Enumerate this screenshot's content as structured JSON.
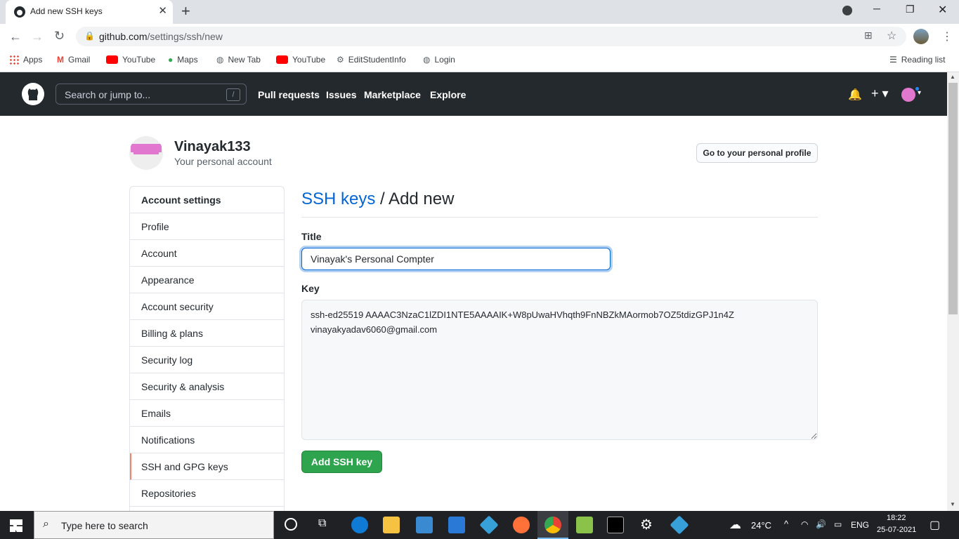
{
  "browser": {
    "tab_title": "Add new SSH keys",
    "url_host": "github.com",
    "url_path": "/settings/ssh/new",
    "bookmarks": [
      "Apps",
      "Gmail",
      "YouTube",
      "Maps",
      "New Tab",
      "YouTube",
      "EditStudentInfo",
      "Login"
    ],
    "reading_list": "Reading list"
  },
  "github": {
    "search_placeholder": "Search or jump to...",
    "search_shortcut": "/",
    "nav": [
      "Pull requests",
      "Issues",
      "Marketplace",
      "Explore"
    ]
  },
  "account": {
    "username": "Vinayak133",
    "subtitle": "Your personal account",
    "profile_button": "Go to your personal profile"
  },
  "sidebar": {
    "heading": "Account settings",
    "items": [
      "Profile",
      "Account",
      "Appearance",
      "Account security",
      "Billing & plans",
      "Security log",
      "Security & analysis",
      "Emails",
      "Notifications",
      "SSH and GPG keys",
      "Repositories"
    ],
    "active": "SSH and GPG keys"
  },
  "form": {
    "breadcrumb_link": "SSH keys",
    "breadcrumb_rest": " / Add new",
    "title_label": "Title",
    "title_value": "Vinayak's Personal Compter",
    "key_label": "Key",
    "key_value": "ssh-ed25519 AAAAC3NzaC1lZDI1NTE5AAAAIK+W8pUwaHVhqth9FnNBZkMAormob7OZ5tdizGPJ1n4Z vinayakyadav6060@gmail.com",
    "submit_label": "Add SSH key"
  },
  "taskbar": {
    "search_placeholder": "Type here to search",
    "weather": "24°C",
    "language": "ENG",
    "time": "18:22",
    "date": "25-07-2021"
  },
  "colors": {
    "github_header": "#24292e",
    "primary_button": "#2ea44f",
    "link": "#0366d6",
    "active_marker": "#f9826c"
  }
}
